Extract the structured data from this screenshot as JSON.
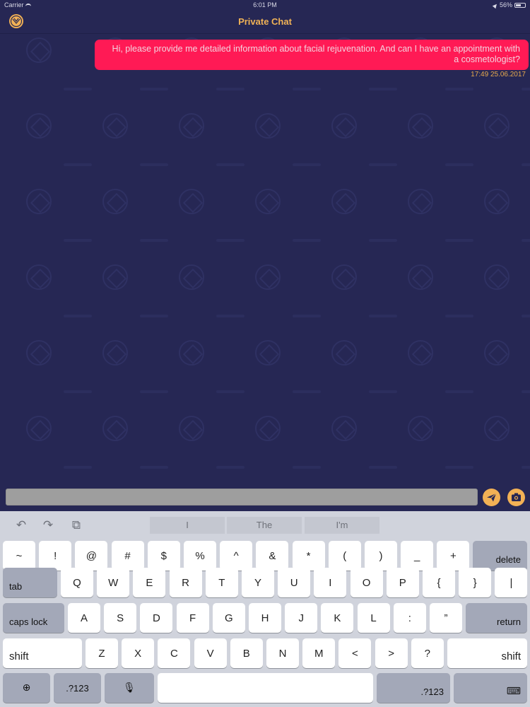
{
  "status_bar": {
    "carrier": "Carrier",
    "time": "6:01 PM",
    "battery": "56%"
  },
  "nav": {
    "title": "Private Chat",
    "logo_icon": "clinic-logo-icon"
  },
  "chat": {
    "messages": [
      {
        "text": "Hi, please provide me detailed information about facial rejuvenation. And can I have an appointment with a cosmetologist?",
        "timestamp": "17:49  25.06.2017"
      }
    ]
  },
  "input": {
    "value": "",
    "placeholder": "",
    "send_icon": "send-icon",
    "camera_icon": "camera-icon"
  },
  "keyboard": {
    "toolbar": {
      "undo_icon": "undo-icon",
      "redo_icon": "redo-icon",
      "paste_icon": "paste-icon"
    },
    "suggestions": [
      "I",
      "The",
      "I'm"
    ],
    "row1": [
      "~",
      "!",
      "@",
      "#",
      "$",
      "%",
      "^",
      "&",
      "*",
      "(",
      ")",
      "_",
      "+"
    ],
    "delete": "delete",
    "tab": "tab",
    "row2": [
      "Q",
      "W",
      "E",
      "R",
      "T",
      "Y",
      "U",
      "I",
      "O",
      "P",
      "{",
      "}",
      "|"
    ],
    "caps_lock": "caps lock",
    "row3": [
      "A",
      "S",
      "D",
      "F",
      "G",
      "H",
      "J",
      "K",
      "L",
      ":",
      "”"
    ],
    "return": "return",
    "shift_left": "shift",
    "row4": [
      "Z",
      "X",
      "C",
      "V",
      "B",
      "N",
      "M",
      "<",
      ">",
      "?"
    ],
    "shift_right": "shift",
    "globe_icon": "globe-icon",
    "numbers_left": ".?123",
    "mic_icon": "microphone-icon",
    "space": "",
    "numbers_right": ".?123",
    "hide_icon": "keyboard-hide-icon"
  },
  "colors": {
    "background": "#262754",
    "accent": "#f2b155",
    "bubble": "#ff1a55"
  }
}
